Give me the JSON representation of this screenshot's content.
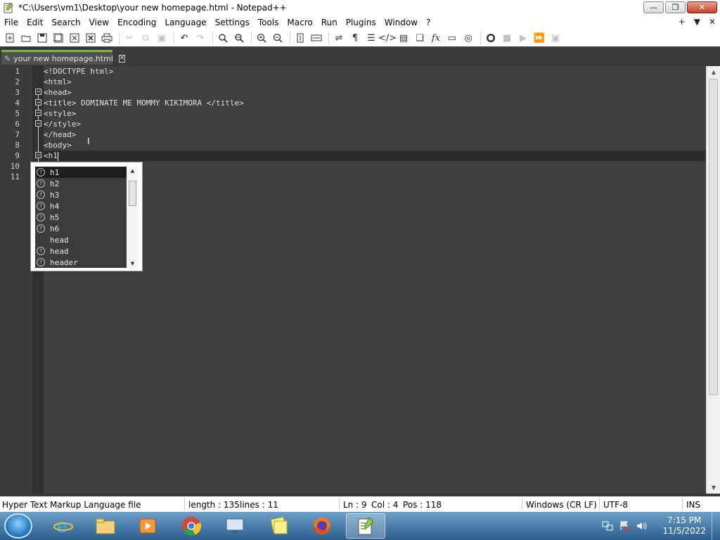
{
  "window": {
    "title": "*C:\\Users\\vm1\\Desktop\\your new homepage.html - Notepad++",
    "minimize_label": "—",
    "restore_label": "❐",
    "close_label": "✕"
  },
  "menu": {
    "items": [
      "File",
      "Edit",
      "Search",
      "View",
      "Encoding",
      "Language",
      "Settings",
      "Tools",
      "Macro",
      "Run",
      "Plugins",
      "Window",
      "?"
    ],
    "right": [
      "+",
      "▼",
      "✕"
    ]
  },
  "tab": {
    "label": "your new homepage.html",
    "close": "✕"
  },
  "editor": {
    "line_numbers": [
      "1",
      "2",
      "3",
      "4",
      "5",
      "6",
      "7",
      "8",
      "9",
      "10",
      "11"
    ],
    "lines": [
      "<!DOCTYPE html>",
      "<html>",
      "<head>",
      "<title> DOMINATE ME MOMMY KIKIMORA </title>",
      "<style>",
      "</style>",
      "</head>",
      "<body>",
      "<h1",
      "",
      ""
    ],
    "current_line": 9
  },
  "autocomplete": {
    "items": [
      "h1",
      "h2",
      "h3",
      "h4",
      "h5",
      "h6",
      "head",
      "head",
      "header"
    ],
    "selected": "h1"
  },
  "status": {
    "file_type": "Hyper Text Markup Language file",
    "length": "length : 135",
    "lines": "lines : 11",
    "ln": "Ln : 9",
    "col": "Col : 4",
    "pos": "Pos : 118",
    "eol": "Windows (CR LF)",
    "encoding": "UTF-8",
    "mode": "INS"
  },
  "taskbar": {
    "time": "7:15 PM",
    "date": "11/5/2022"
  },
  "colors": {
    "tab_accent": "#7fb84a",
    "editor_bg": "#3f3f3f",
    "taskbar": "#2d5f8e"
  }
}
